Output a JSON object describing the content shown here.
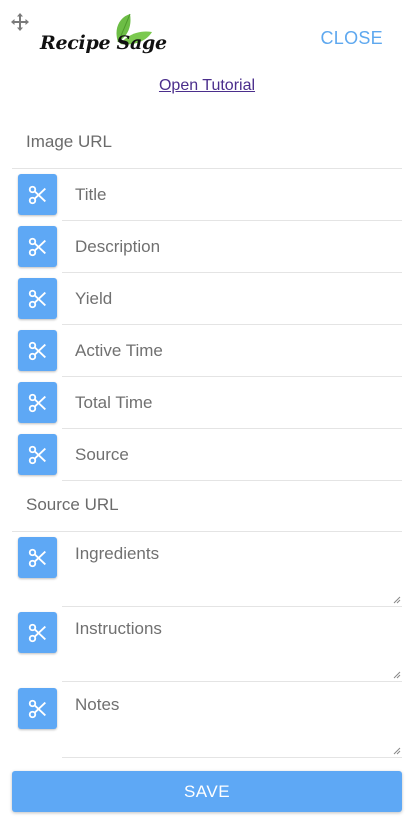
{
  "header": {
    "logo_text": "Recipe Sage",
    "close_label": "CLOSE",
    "tutorial_label": "Open Tutorial",
    "accent_color": "#5ea8f5",
    "leaf_color": "#6cbd45"
  },
  "form": {
    "image_url_label": "Image URL",
    "source_url_label": "Source URL",
    "fields": [
      {
        "label": "Title"
      },
      {
        "label": "Description"
      },
      {
        "label": "Yield"
      },
      {
        "label": "Active Time"
      },
      {
        "label": "Total Time"
      },
      {
        "label": "Source"
      },
      {
        "label": "Ingredients"
      },
      {
        "label": "Instructions"
      },
      {
        "label": "Notes"
      }
    ],
    "button_icon": "scissors-icon"
  },
  "footer": {
    "save_label": "SAVE"
  }
}
